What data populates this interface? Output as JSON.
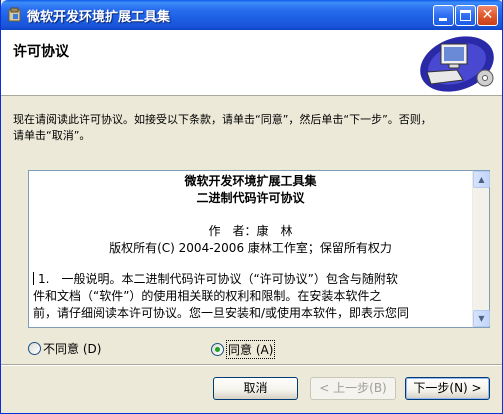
{
  "window": {
    "title": "微软开发环境扩展工具集"
  },
  "header": {
    "title": "许可协议"
  },
  "instructions": {
    "line1": "现在请阅读此许可协议。如接受以下条款，请单击“同意”，然后单击“下一步”。否则，",
    "line2": "请单击“取消”。"
  },
  "license": {
    "title": "微软开发环境扩展工具集",
    "subtitle": "二进制代码许可协议",
    "author": "作　者：康　林",
    "copyright": "版权所有(C) 2004-2006 康林工作室；保留所有权力",
    "para_line1": "1.　一般说明。本二进制代码许可协议（“许可协议”）包含与随附软",
    "para_line2": "件和文档（“软件”）的使用相关联的权利和限制。在安装本软件之",
    "para_line3": "前，请仔细阅读本许可协议。您一旦安装和/或使用本软件，即表示您同"
  },
  "options": {
    "disagree_label": "不同意",
    "disagree_hotkey": "(D)",
    "agree_label": "同意",
    "agree_hotkey": "(A)",
    "selected": "agree"
  },
  "buttons": {
    "cancel": "取消",
    "back": "< 上一步(B)",
    "next": "下一步(N) >"
  },
  "icons": {
    "window_icon": "installer-icon",
    "header_icon": "computer-setup-icon"
  },
  "colors": {
    "titlebar": "#1c5fe4",
    "dialog_bg": "#ece9d8",
    "radio_dot": "#21a121"
  }
}
